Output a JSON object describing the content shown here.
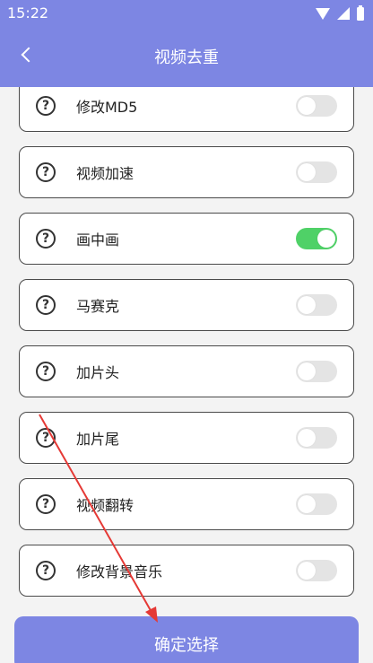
{
  "status_bar": {
    "time": "15:22",
    "icons": [
      "wifi-icon",
      "signal-icon",
      "battery-icon"
    ]
  },
  "header": {
    "title": "视频去重",
    "back_icon": "chevron-left-icon"
  },
  "items": [
    {
      "label": "修改MD5",
      "enabled": false
    },
    {
      "label": "视频加速",
      "enabled": false
    },
    {
      "label": "画中画",
      "enabled": true
    },
    {
      "label": "马赛克",
      "enabled": false
    },
    {
      "label": "加片头",
      "enabled": false
    },
    {
      "label": "加片尾",
      "enabled": false
    },
    {
      "label": "视频翻转",
      "enabled": false
    },
    {
      "label": "修改背景音乐",
      "enabled": false
    }
  ],
  "help_glyph": "?",
  "confirm_label": "确定选择",
  "colors": {
    "header": "#7d86e3",
    "toggle_on": "#4fd167",
    "toggle_off": "#e4e4e4",
    "annotation_arrow": "#e53935"
  }
}
